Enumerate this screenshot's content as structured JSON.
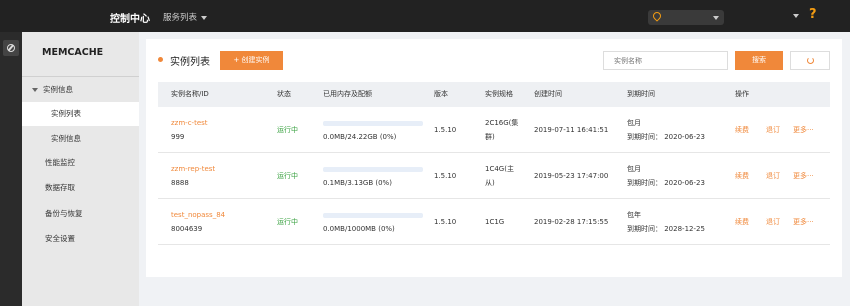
{
  "header": {
    "brand": "控制中心",
    "services_label": "服务列表",
    "help": "?"
  },
  "sidebar": {
    "title": "MEMCACHE",
    "items": [
      {
        "label": "实例信息"
      },
      {
        "label": "实例列表"
      },
      {
        "label": "实例信息"
      },
      {
        "label": "性能监控"
      },
      {
        "label": "数据存取"
      },
      {
        "label": "备份与恢复"
      },
      {
        "label": "安全设置"
      }
    ]
  },
  "main": {
    "title": "实例列表",
    "create_button": "+ 创建实例",
    "search_placeholder": "实例名称",
    "search_button": "搜索",
    "columns": [
      "实例名称/ID",
      "状态",
      "已用内存及配额",
      "版本",
      "实例规格",
      "创建时间",
      "到期时间",
      "操作"
    ],
    "rows": [
      {
        "name": "zzm-c-test",
        "id": "999",
        "status": "运行中",
        "usage": 0.0,
        "memory": "0.0MB/24.22GB (0%)",
        "version": "1.5.10",
        "spec_line1": "2C16G(集",
        "spec_line2": "群)",
        "created": "2019-07-11 16:41:51",
        "billing": "包月",
        "expire": "到期时间： 2020-06-23",
        "op_renew": "续费",
        "op_refund": "退订",
        "op_more": "更多"
      },
      {
        "name": "zzm-rep-test",
        "id": "8888",
        "status": "运行中",
        "usage": 0.0,
        "memory": "0.1MB/3.13GB (0%)",
        "version": "1.5.10",
        "spec_line1": "1C4G(主",
        "spec_line2": "从)",
        "created": "2019-05-23 17:47:00",
        "billing": "包月",
        "expire": "到期时间： 2020-06-23",
        "op_renew": "续费",
        "op_refund": "退订",
        "op_more": "更多"
      },
      {
        "name": "test_nopass_84",
        "id": "8004639",
        "status": "运行中",
        "usage": 0.0,
        "memory": "0.0MB/1000MB (0%)",
        "version": "1.5.10",
        "spec_line1": "1C1G",
        "spec_line2": "",
        "created": "2019-02-28 17:15:55",
        "billing": "包年",
        "expire": "到期时间： 2028-12-25",
        "op_renew": "续费",
        "op_refund": "退订",
        "op_more": "更多"
      }
    ]
  },
  "colors": {
    "accent": "#f0883a",
    "running": "#3aa241",
    "topbar": "#222222",
    "sidebar": "#e8e8e8"
  }
}
